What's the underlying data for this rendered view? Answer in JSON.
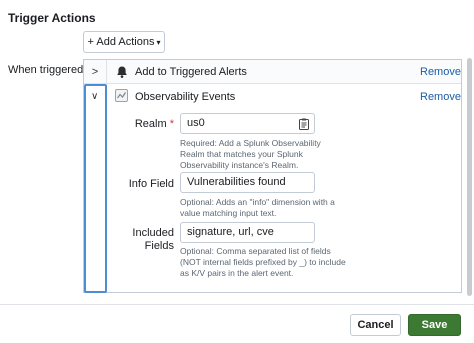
{
  "page": {
    "title": "Trigger Actions"
  },
  "toolbar": {
    "add_actions_label": "+ Add Actions",
    "add_actions_caret": "▾"
  },
  "form": {
    "when_triggered_label": "When triggered"
  },
  "actions": [
    {
      "title": "Add to Triggered Alerts",
      "remove_label": "Remove",
      "expanded": false,
      "icon": "bell-icon"
    },
    {
      "title": "Observability Events",
      "remove_label": "Remove",
      "expanded": true,
      "icon": "observability-icon",
      "fields": {
        "realm": {
          "label": "Realm",
          "required_marker": "*",
          "value": "us0",
          "help_lines": [
            "Required: Add a Splunk Observability",
            "Realm that matches your Splunk",
            "Observability instance's Realm."
          ]
        },
        "info": {
          "label": "Info Field",
          "value": "Vulnerabilities found",
          "help_lines": [
            "Optional: Adds an \"info\" dimension with a",
            "value matching input text."
          ]
        },
        "included": {
          "label_line1": "Included",
          "label_line2": "Fields",
          "value": "signature, url, cve",
          "help_lines": [
            "Optional: Comma separated list of fields",
            "(NOT internal fields prefixed by _) to include",
            "as K/V pairs in the alert event."
          ]
        }
      }
    }
  ],
  "footer": {
    "cancel_label": "Cancel",
    "save_label": "Save"
  },
  "colors": {
    "primary": "#3c7a33",
    "link": "#1a5fa5",
    "required": "#d6363f",
    "focus": "#4d8dd6"
  }
}
